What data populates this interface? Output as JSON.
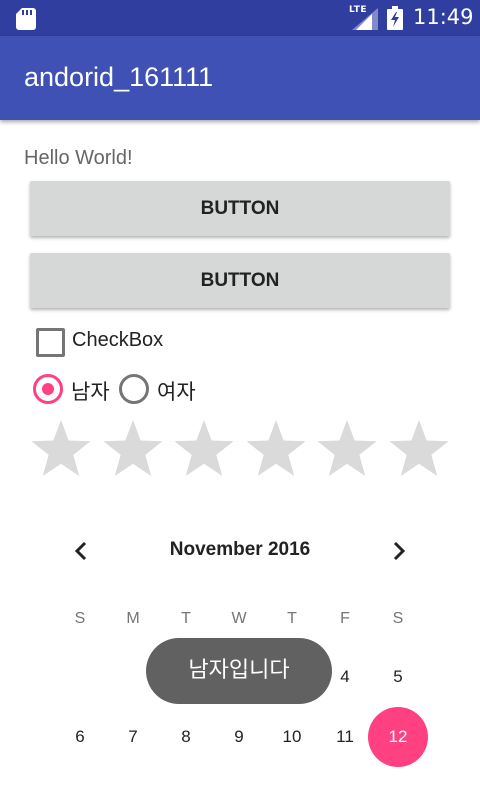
{
  "status_bar": {
    "network": "LTE",
    "time": "11:49",
    "icons": [
      "sd-card-icon",
      "signal-icon",
      "battery-icon"
    ]
  },
  "app_bar": {
    "title": "andorid_161111"
  },
  "content": {
    "hello_text": "Hello World!",
    "button1_label": "BUTTON",
    "button2_label": "BUTTON",
    "checkbox": {
      "label": "CheckBox",
      "checked": false
    },
    "radio_group": [
      {
        "label": "남자",
        "checked": true
      },
      {
        "label": "여자",
        "checked": false
      }
    ],
    "rating": {
      "stars": 6,
      "value": 0
    }
  },
  "calendar": {
    "month_label": "November 2016",
    "weekdays": [
      "S",
      "M",
      "T",
      "W",
      "T",
      "F",
      "S"
    ],
    "visible_days": [
      "4",
      "5",
      "6",
      "7",
      "8",
      "9",
      "10",
      "11",
      "12"
    ],
    "selected_day": "12"
  },
  "toast": {
    "text": "남자입니다"
  },
  "colors": {
    "status_bar": "#303F9F",
    "app_bar": "#3F51B5",
    "accent": "#FF4081",
    "button": "#D6D7D7",
    "toast": "#616161"
  }
}
